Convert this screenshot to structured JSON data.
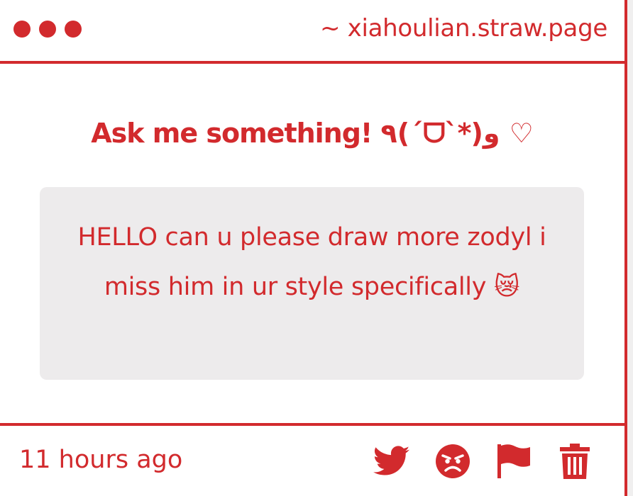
{
  "colors": {
    "accent": "#d22a2d",
    "question_bg": "#edebec",
    "background": "#ffffff"
  },
  "titlebar": {
    "site": "~ xiahoulian.straw.page",
    "dots": [
      "window-dot",
      "window-dot",
      "window-dot"
    ]
  },
  "main": {
    "heading": "Ask me something! ٩(´ᗜ`*)و ♡",
    "question": "HELLO can u please draw more zodyl i miss him in ur style specifically 😿"
  },
  "footer": {
    "timestamp": "11 hours ago",
    "actions": [
      "twitter-icon",
      "angry-face-icon",
      "flag-icon",
      "trash-icon"
    ]
  }
}
